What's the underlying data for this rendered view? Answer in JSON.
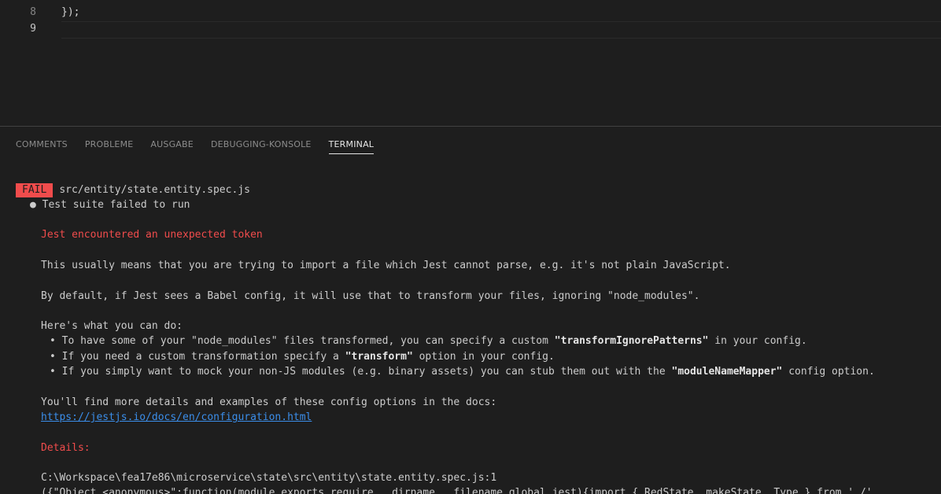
{
  "editor": {
    "lines": [
      {
        "num": "8",
        "code": "});"
      },
      {
        "num": "9",
        "code": ""
      }
    ]
  },
  "panel": {
    "tabs": [
      "COMMENTS",
      "PROBLEME",
      "AUSGABE",
      "DEBUGGING-KONSOLE",
      "TERMINAL"
    ],
    "active_tab": "TERMINAL"
  },
  "terminal": {
    "fail_badge": "FAIL",
    "fail_file": "src/entity/state.entity.spec.js",
    "suite_line": "● Test suite failed to run",
    "error_title": "Jest encountered an unexpected token",
    "usually_line": "This usually means that you are trying to import a file which Jest cannot parse, e.g. it's not plain JavaScript.",
    "default_line": "By default, if Jest sees a Babel config, it will use that to transform your files, ignoring \"node_modules\".",
    "can_do_line": "Here's what you can do:",
    "bullet1_pre": "• To have some of your \"node_modules\" files transformed, you can specify a custom ",
    "bullet1_bold": "\"transformIgnorePatterns\"",
    "bullet1_post": " in your config.",
    "bullet2_pre": "• If you need a custom transformation specify a ",
    "bullet2_bold": "\"transform\"",
    "bullet2_post": " option in your config.",
    "bullet3_pre": "• If you simply want to mock your non-JS modules (e.g. binary assets) you can stub them out with the ",
    "bullet3_bold": "\"moduleNameMapper\"",
    "bullet3_post": " config option.",
    "docs_line": "You'll find more details and examples of these config options in the docs:",
    "docs_link": "https://jestjs.io/docs/en/configuration.html",
    "details_label": "Details:",
    "path_line": "C:\\Workspace\\fea17e86\\microservice\\state\\src\\entity\\state.entity.spec.js:1",
    "object_line": "({\"Object.<anonymous>\":function(module,exports,require,__dirname,__filename,global,jest){import { RedState, makeState, Type } from './'"
  },
  "colors": {
    "background": "#1e1e1e",
    "error_red": "#f14c4c",
    "link_blue": "#3b8eea"
  }
}
